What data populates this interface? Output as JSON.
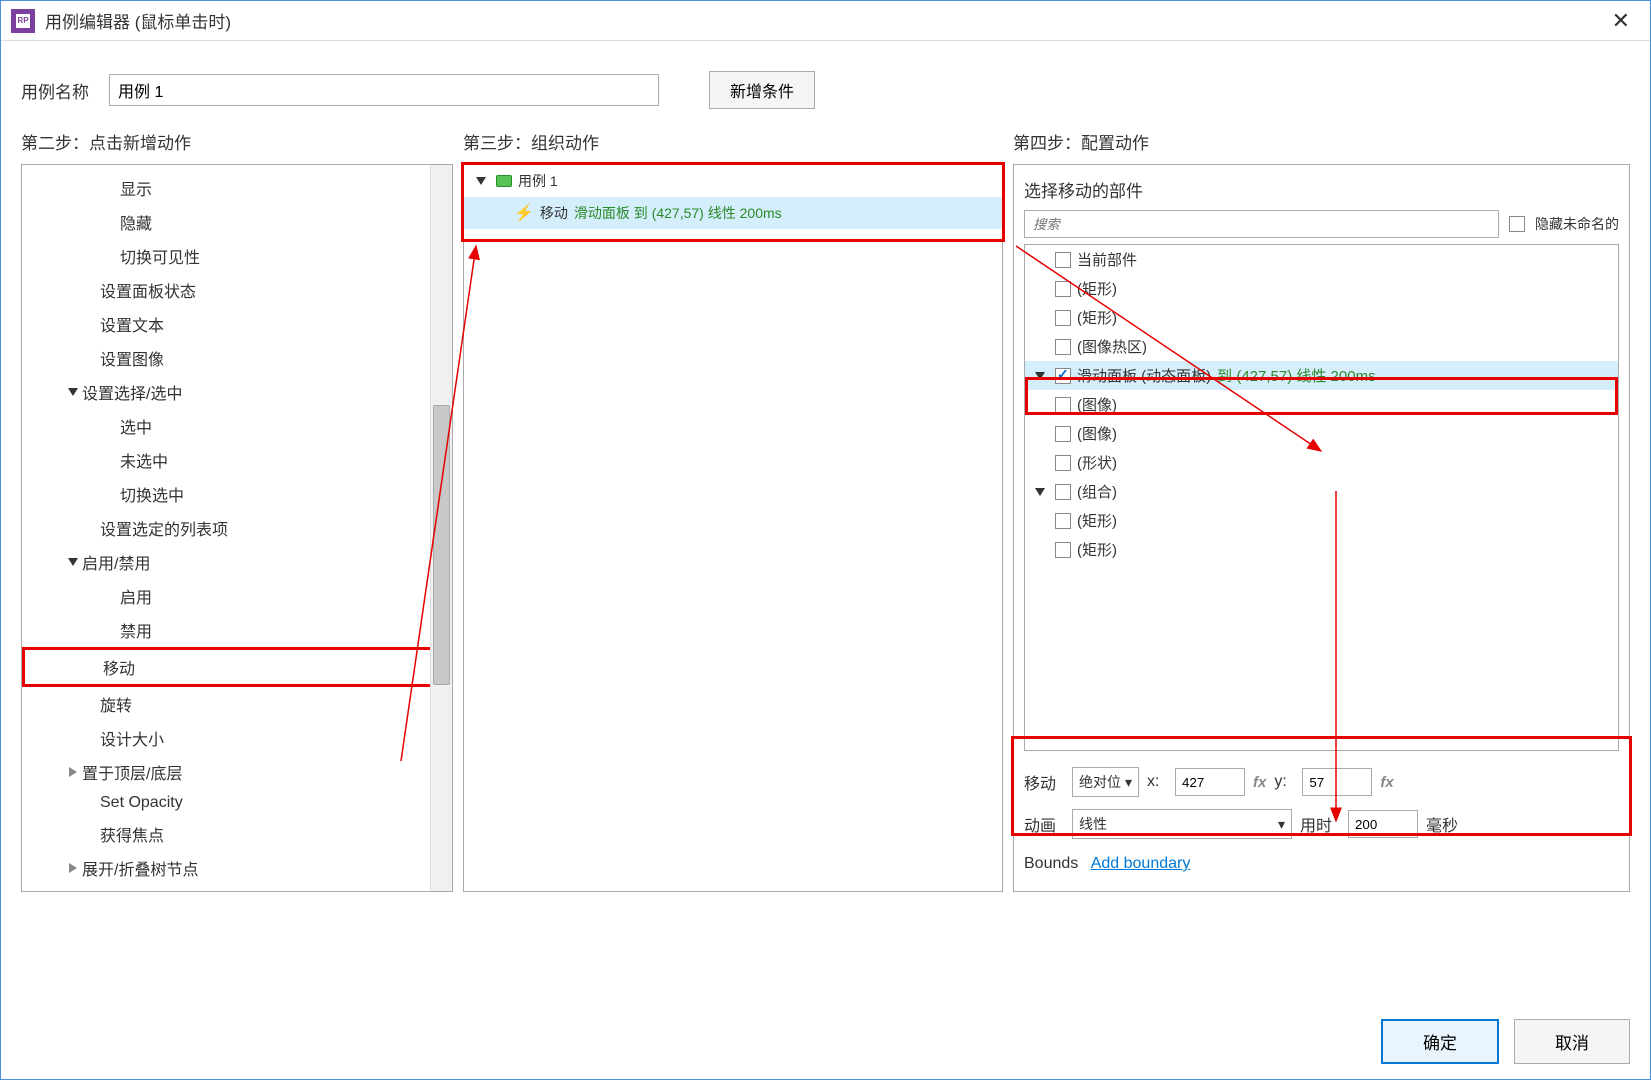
{
  "window": {
    "title": "用例编辑器 (鼠标单击时)"
  },
  "nameRow": {
    "label": "用例名称",
    "value": "用例 1",
    "addCondition": "新增条件"
  },
  "step2": {
    "label": "第二步：点击新增动作",
    "items": [
      {
        "text": "显示",
        "indent": 1
      },
      {
        "text": "隐藏",
        "indent": 1
      },
      {
        "text": "切换可见性",
        "indent": 1
      },
      {
        "text": "设置面板状态",
        "indent": 0
      },
      {
        "text": "设置文本",
        "indent": 0
      },
      {
        "text": "设置图像",
        "indent": 0
      },
      {
        "text": "设置选择/选中",
        "indent": 0,
        "exp": "down"
      },
      {
        "text": "选中",
        "indent": 1
      },
      {
        "text": "未选中",
        "indent": 1
      },
      {
        "text": "切换选中",
        "indent": 1
      },
      {
        "text": "设置选定的列表项",
        "indent": 0
      },
      {
        "text": "启用/禁用",
        "indent": 0,
        "exp": "down"
      },
      {
        "text": "启用",
        "indent": 1
      },
      {
        "text": "禁用",
        "indent": 1
      },
      {
        "text": "移动",
        "indent": 0,
        "highlight": true
      },
      {
        "text": "旋转",
        "indent": 0
      },
      {
        "text": "设计大小",
        "indent": 0
      },
      {
        "text": "置于顶层/底层",
        "indent": 0,
        "exp": "right"
      },
      {
        "text": "Set Opacity",
        "indent": 0
      },
      {
        "text": "获得焦点",
        "indent": 0
      },
      {
        "text": "展开/折叠树节点",
        "indent": 0,
        "exp": "right"
      }
    ]
  },
  "step3": {
    "label": "第三步：组织动作",
    "caseName": "用例 1",
    "action": {
      "prefix": "移动",
      "green": "滑动面板 到 (427,57) 线性 200ms"
    }
  },
  "step4": {
    "label": "第四步：配置动作",
    "header": "选择移动的部件",
    "searchPlaceholder": "搜索",
    "hideUnnamed": "隐藏未命名的",
    "widgets": [
      {
        "text": "当前部件",
        "indent": 1
      },
      {
        "text": "(矩形)",
        "indent": 1
      },
      {
        "text": "(矩形)",
        "indent": 1
      },
      {
        "text": "(图像热区)",
        "indent": 1
      },
      {
        "text": "滑动面板 (动态面板)",
        "green": "到 (427,57) 线性 200ms",
        "indent": 1,
        "checked": true,
        "selected": true,
        "exp": true
      },
      {
        "text": "(图像)",
        "indent": 2
      },
      {
        "text": "(图像)",
        "indent": 1
      },
      {
        "text": "(形状)",
        "indent": 1
      },
      {
        "text": "(组合)",
        "indent": 1,
        "exp": true
      },
      {
        "text": "(矩形)",
        "indent": 2
      },
      {
        "text": "(矩形)",
        "indent": 2
      }
    ],
    "config": {
      "moveLabel": "移动",
      "moveType": "绝对位",
      "xLabel": "x:",
      "xValue": "427",
      "yLabel": "y:",
      "yValue": "57",
      "animLabel": "动画",
      "animType": "线性",
      "durLabel": "用时",
      "durValue": "200",
      "durUnit": "毫秒",
      "boundsLabel": "Bounds",
      "boundsLink": "Add boundary"
    }
  },
  "footer": {
    "ok": "确定",
    "cancel": "取消"
  }
}
